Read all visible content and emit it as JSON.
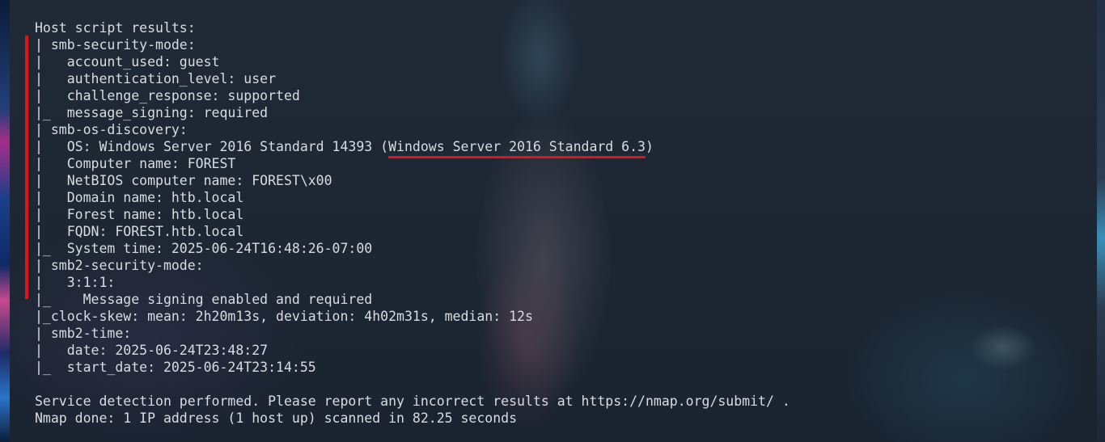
{
  "terminal": {
    "lines": {
      "l0": "Host script results:",
      "l1": "| smb-security-mode:",
      "l2": "|   account_used: guest",
      "l3": "|   authentication_level: user",
      "l4": "|   challenge_response: supported",
      "l5": "|_  message_signing: required",
      "l6": "| smb-os-discovery:",
      "l7a": "|   OS: Windows Server 2016 Standard 14393 (",
      "l7b": "Windows Server 2016 Standard 6.3",
      "l7c": ")",
      "l8": "|   Computer name: FOREST",
      "l9": "|   NetBIOS computer name: FOREST\\x00",
      "l10": "|   Domain name: htb.local",
      "l11": "|   Forest name: htb.local",
      "l12": "|   FQDN: FOREST.htb.local",
      "l13": "|_  System time: 2025-06-24T16:48:26-07:00",
      "l14": "| smb2-security-mode:",
      "l15": "|   3:1:1:",
      "l16": "|_    Message signing enabled and required",
      "l17": "|_clock-skew: mean: 2h20m13s, deviation: 4h02m31s, median: 12s",
      "l18": "| smb2-time:",
      "l19": "|   date: 2025-06-24T23:48:27",
      "l20": "|_  start_date: 2025-06-24T23:14:55",
      "l21": "",
      "l22": "Service detection performed. Please report any incorrect results at https://nmap.org/submit/ .",
      "l23": "Nmap done: 1 IP address (1 host up) scanned in 82.25 seconds"
    }
  },
  "colors": {
    "text": "#d9dce0",
    "annotation": "#e0151b",
    "background": "#1a2230"
  }
}
